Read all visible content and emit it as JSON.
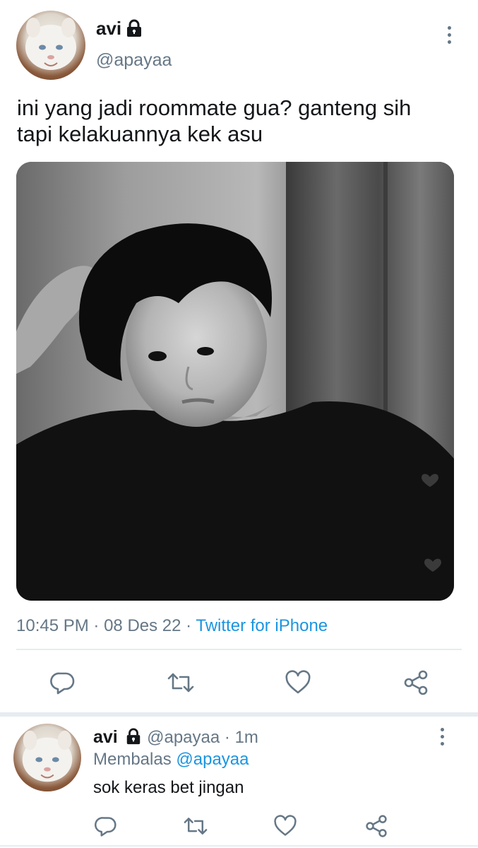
{
  "tweet": {
    "display_name": "avi",
    "handle": "@apayaa",
    "text_line1": "ini yang jadi roommate gua? ganteng sih",
    "text_line2": "tapi kelakuannya kek asu",
    "time": "10:45 PM",
    "sep": "·",
    "date": "08 Des 22",
    "source": "Twitter for iPhone"
  },
  "reply": {
    "display_name": "avi",
    "handle": "@apayaa",
    "sep": "·",
    "age": "1m",
    "replying_label": "Membalas",
    "replying_to": "@apayaa",
    "text": "sok keras bet jingan"
  },
  "icons": {
    "lock": "lock-icon",
    "more": "more-vertical-icon",
    "reply": "reply-icon",
    "retweet": "retweet-icon",
    "like": "heart-icon",
    "share": "share-icon"
  },
  "colors": {
    "text": "#14171a",
    "secondary": "#657786",
    "link": "#1b95e0",
    "divider": "#e6ecf0"
  }
}
